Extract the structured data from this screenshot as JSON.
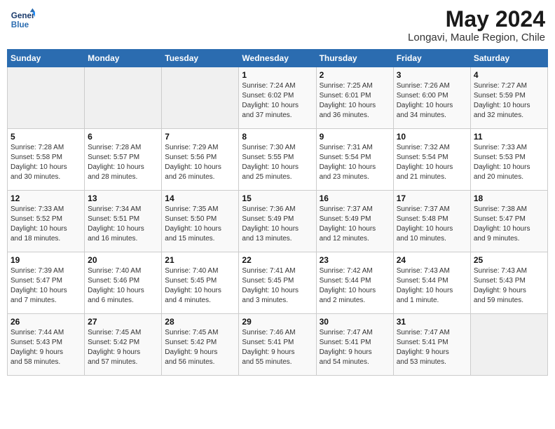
{
  "logo": {
    "line1": "General",
    "line2": "Blue"
  },
  "title": "May 2024",
  "location": "Longavi, Maule Region, Chile",
  "days_header": [
    "Sunday",
    "Monday",
    "Tuesday",
    "Wednesday",
    "Thursday",
    "Friday",
    "Saturday"
  ],
  "weeks": [
    [
      {
        "day": "",
        "info": ""
      },
      {
        "day": "",
        "info": ""
      },
      {
        "day": "",
        "info": ""
      },
      {
        "day": "1",
        "info": "Sunrise: 7:24 AM\nSunset: 6:02 PM\nDaylight: 10 hours\nand 37 minutes."
      },
      {
        "day": "2",
        "info": "Sunrise: 7:25 AM\nSunset: 6:01 PM\nDaylight: 10 hours\nand 36 minutes."
      },
      {
        "day": "3",
        "info": "Sunrise: 7:26 AM\nSunset: 6:00 PM\nDaylight: 10 hours\nand 34 minutes."
      },
      {
        "day": "4",
        "info": "Sunrise: 7:27 AM\nSunset: 5:59 PM\nDaylight: 10 hours\nand 32 minutes."
      }
    ],
    [
      {
        "day": "5",
        "info": "Sunrise: 7:28 AM\nSunset: 5:58 PM\nDaylight: 10 hours\nand 30 minutes."
      },
      {
        "day": "6",
        "info": "Sunrise: 7:28 AM\nSunset: 5:57 PM\nDaylight: 10 hours\nand 28 minutes."
      },
      {
        "day": "7",
        "info": "Sunrise: 7:29 AM\nSunset: 5:56 PM\nDaylight: 10 hours\nand 26 minutes."
      },
      {
        "day": "8",
        "info": "Sunrise: 7:30 AM\nSunset: 5:55 PM\nDaylight: 10 hours\nand 25 minutes."
      },
      {
        "day": "9",
        "info": "Sunrise: 7:31 AM\nSunset: 5:54 PM\nDaylight: 10 hours\nand 23 minutes."
      },
      {
        "day": "10",
        "info": "Sunrise: 7:32 AM\nSunset: 5:54 PM\nDaylight: 10 hours\nand 21 minutes."
      },
      {
        "day": "11",
        "info": "Sunrise: 7:33 AM\nSunset: 5:53 PM\nDaylight: 10 hours\nand 20 minutes."
      }
    ],
    [
      {
        "day": "12",
        "info": "Sunrise: 7:33 AM\nSunset: 5:52 PM\nDaylight: 10 hours\nand 18 minutes."
      },
      {
        "day": "13",
        "info": "Sunrise: 7:34 AM\nSunset: 5:51 PM\nDaylight: 10 hours\nand 16 minutes."
      },
      {
        "day": "14",
        "info": "Sunrise: 7:35 AM\nSunset: 5:50 PM\nDaylight: 10 hours\nand 15 minutes."
      },
      {
        "day": "15",
        "info": "Sunrise: 7:36 AM\nSunset: 5:49 PM\nDaylight: 10 hours\nand 13 minutes."
      },
      {
        "day": "16",
        "info": "Sunrise: 7:37 AM\nSunset: 5:49 PM\nDaylight: 10 hours\nand 12 minutes."
      },
      {
        "day": "17",
        "info": "Sunrise: 7:37 AM\nSunset: 5:48 PM\nDaylight: 10 hours\nand 10 minutes."
      },
      {
        "day": "18",
        "info": "Sunrise: 7:38 AM\nSunset: 5:47 PM\nDaylight: 10 hours\nand 9 minutes."
      }
    ],
    [
      {
        "day": "19",
        "info": "Sunrise: 7:39 AM\nSunset: 5:47 PM\nDaylight: 10 hours\nand 7 minutes."
      },
      {
        "day": "20",
        "info": "Sunrise: 7:40 AM\nSunset: 5:46 PM\nDaylight: 10 hours\nand 6 minutes."
      },
      {
        "day": "21",
        "info": "Sunrise: 7:40 AM\nSunset: 5:45 PM\nDaylight: 10 hours\nand 4 minutes."
      },
      {
        "day": "22",
        "info": "Sunrise: 7:41 AM\nSunset: 5:45 PM\nDaylight: 10 hours\nand 3 minutes."
      },
      {
        "day": "23",
        "info": "Sunrise: 7:42 AM\nSunset: 5:44 PM\nDaylight: 10 hours\nand 2 minutes."
      },
      {
        "day": "24",
        "info": "Sunrise: 7:43 AM\nSunset: 5:44 PM\nDaylight: 10 hours\nand 1 minute."
      },
      {
        "day": "25",
        "info": "Sunrise: 7:43 AM\nSunset: 5:43 PM\nDaylight: 9 hours\nand 59 minutes."
      }
    ],
    [
      {
        "day": "26",
        "info": "Sunrise: 7:44 AM\nSunset: 5:43 PM\nDaylight: 9 hours\nand 58 minutes."
      },
      {
        "day": "27",
        "info": "Sunrise: 7:45 AM\nSunset: 5:42 PM\nDaylight: 9 hours\nand 57 minutes."
      },
      {
        "day": "28",
        "info": "Sunrise: 7:45 AM\nSunset: 5:42 PM\nDaylight: 9 hours\nand 56 minutes."
      },
      {
        "day": "29",
        "info": "Sunrise: 7:46 AM\nSunset: 5:41 PM\nDaylight: 9 hours\nand 55 minutes."
      },
      {
        "day": "30",
        "info": "Sunrise: 7:47 AM\nSunset: 5:41 PM\nDaylight: 9 hours\nand 54 minutes."
      },
      {
        "day": "31",
        "info": "Sunrise: 7:47 AM\nSunset: 5:41 PM\nDaylight: 9 hours\nand 53 minutes."
      },
      {
        "day": "",
        "info": ""
      }
    ]
  ]
}
